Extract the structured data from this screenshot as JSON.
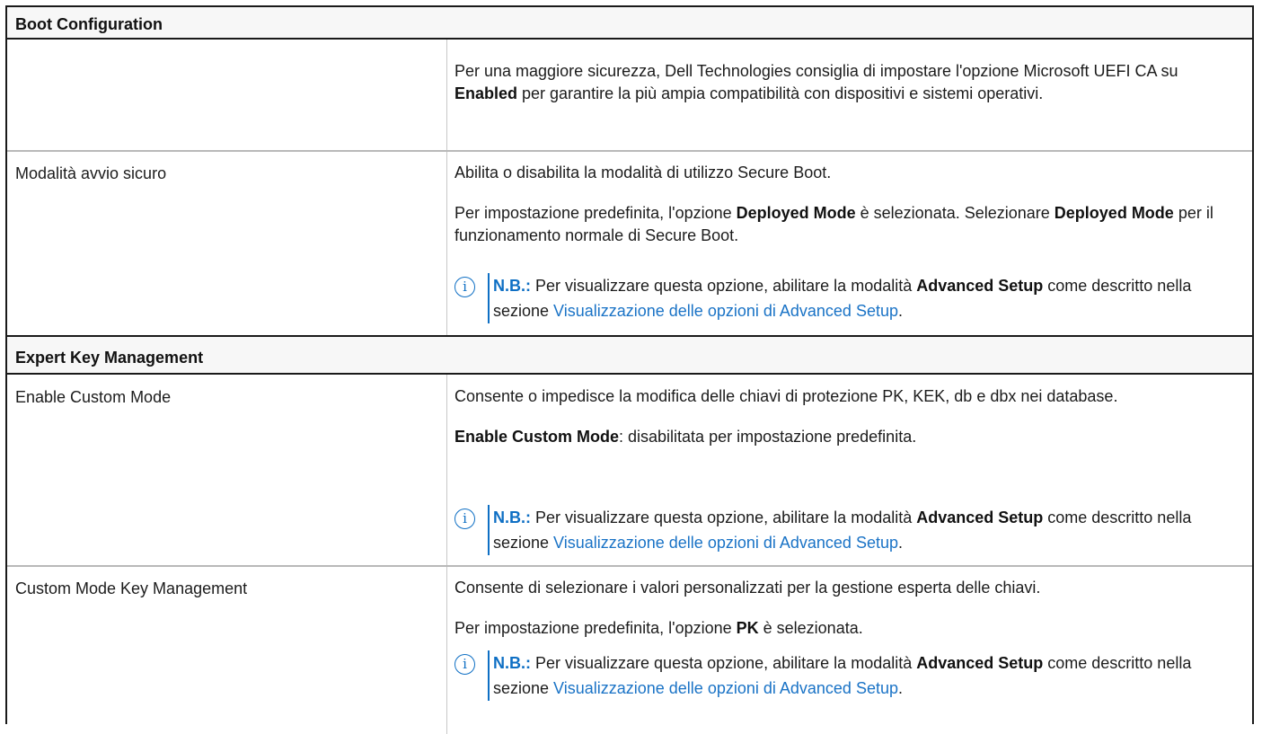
{
  "sections": [
    {
      "title": "Boot Configuration"
    },
    {
      "title": "Expert Key Management"
    }
  ],
  "rows": {
    "microsoft_uefi": {
      "label": "",
      "desc1_a": "Per una maggiore sicurezza, Dell Technologies consiglia di impostare l'opzione Microsoft UEFI CA su ",
      "desc1_b": "Enabled",
      "desc1_c": " per garantire la più ampia compatibilità con dispositivi e sistemi operativi."
    },
    "secure_boot_mode": {
      "label": "Modalità avvio sicuro",
      "desc1": "Abilita o disabilita la modalità di utilizzo Secure Boot.",
      "desc2_a": "Per impostazione predefinita, l'opzione ",
      "desc2_b": "Deployed Mode",
      "desc2_c": " è selezionata. Selezionare ",
      "desc2_d": "Deployed Mode",
      "desc2_e": " per il funzionamento normale di Secure Boot."
    },
    "enable_custom_mode": {
      "label": "Enable Custom Mode",
      "desc1": "Consente o impedisce la modifica delle chiavi di protezione PK, KEK, db e dbx nei database.",
      "desc2_a": "Enable Custom Mode",
      "desc2_b": ": disabilitata per impostazione predefinita."
    },
    "custom_mode_key_mgmt": {
      "label": "Custom Mode Key Management",
      "desc1": "Consente di selezionare i valori personalizzati per la gestione esperta delle chiavi.",
      "desc2_a": "Per impostazione predefinita, l'opzione ",
      "desc2_b": "PK",
      "desc2_c": " è selezionata."
    }
  },
  "note": {
    "icon": "info-icon",
    "prefix": "N.B.:",
    "text_a": " Per visualizzare questa opzione, abilitare la modalità ",
    "bold": "Advanced Setup",
    "text_b": " come descritto nella sezione ",
    "link": "Visualizzazione delle opzioni di Advanced Setup",
    "text_c": "."
  },
  "colors": {
    "accent": "#0e6fc4",
    "link": "#1a73c6",
    "header_bg": "#f7f7f7"
  }
}
